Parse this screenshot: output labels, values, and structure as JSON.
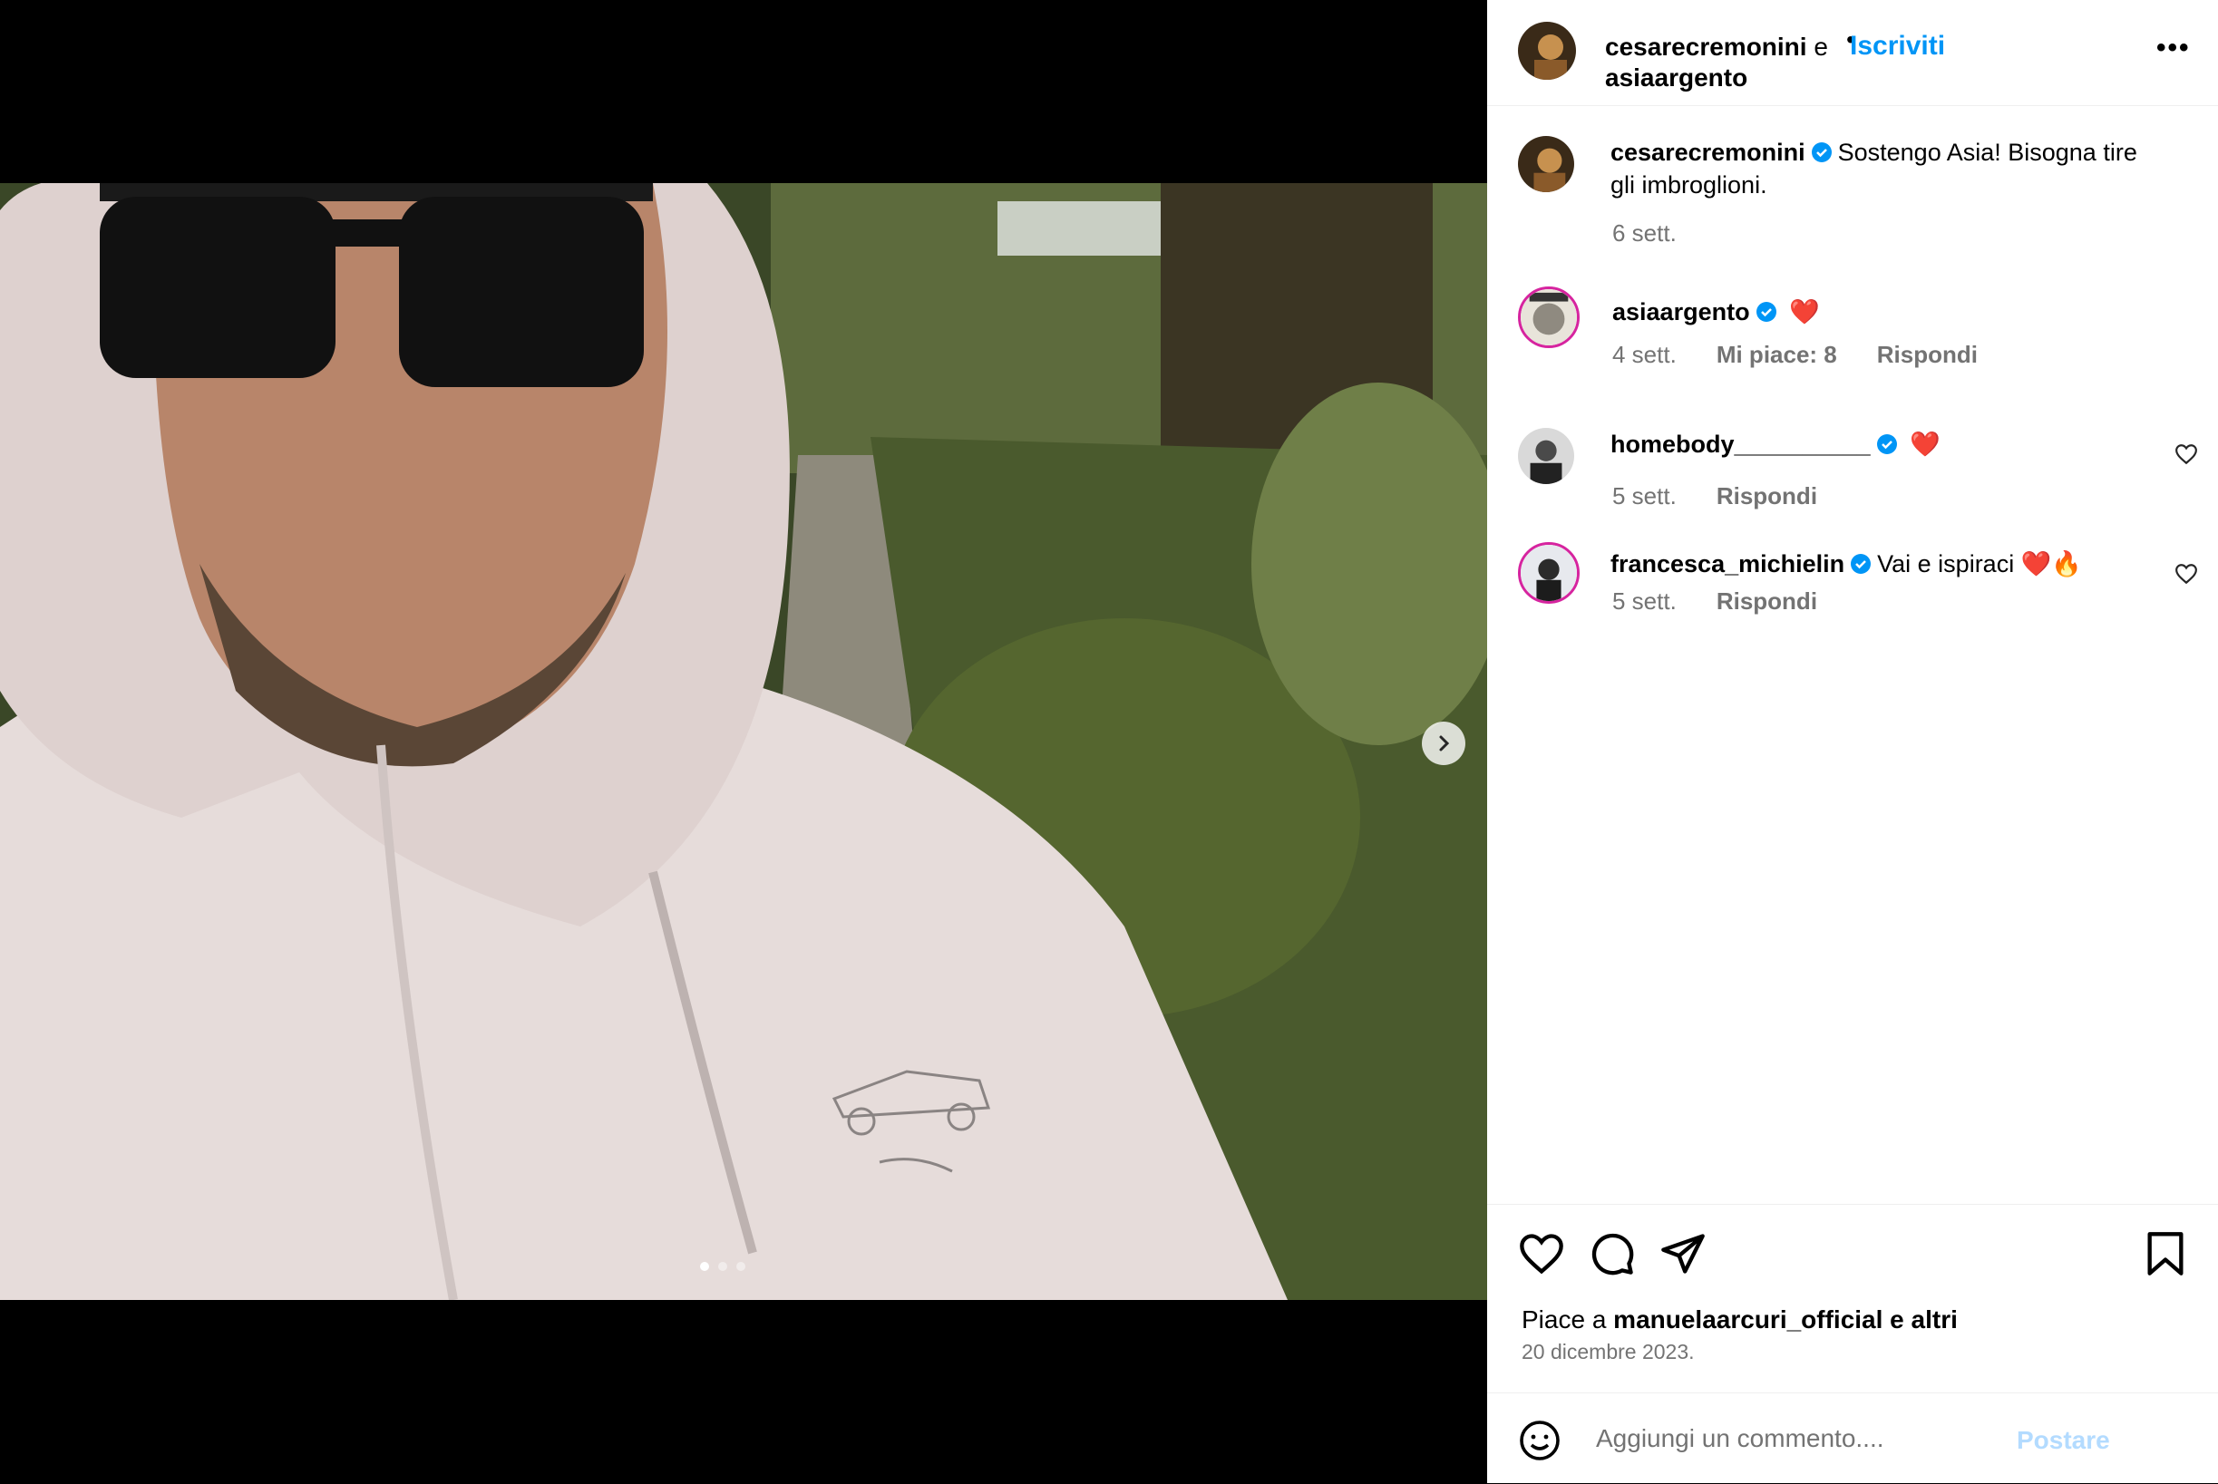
{
  "colors": {
    "accent": "#0095f6",
    "verified": "#0095f6",
    "muted": "#737373",
    "heart": "#e0141e",
    "post_disabled": "#b3dbff"
  },
  "header": {
    "author": "cesarecremonini",
    "conjunction": "e",
    "collaborator": "asiaargento",
    "bullet": "•",
    "follow_label": "Iscriviti",
    "more_label": "•••"
  },
  "caption": {
    "username": "cesarecremonini",
    "text_line1": "Sostengo Asia! Bisogna tire",
    "text_line2": "gli imbroglioni.",
    "time": "6 sett."
  },
  "comments": [
    {
      "username": "asiaargento",
      "text": "❤️",
      "time": "4 sett.",
      "likes": "Mi piace: 8",
      "reply": "Rispondi"
    },
    {
      "username": "homebody__________",
      "text": "❤️",
      "time": "5 sett.",
      "reply": "Rispondi"
    },
    {
      "username": "francesca_michielin",
      "text": "Vai e ispiraci ❤️🔥",
      "time": "5 sett.",
      "reply": "Rispondi"
    }
  ],
  "actions": {
    "icons": [
      "heart-icon",
      "comment-icon",
      "share-icon",
      "bookmark-icon"
    ]
  },
  "likes": {
    "prefix": "Piace a ",
    "user": "manuelaarcuri_official",
    "suffix": " e altri"
  },
  "date": "20 dicembre 2023.",
  "add_comment": {
    "placeholder": "Aggiungi un commento....",
    "post_label": "Postare"
  },
  "carousel": {
    "current": 1,
    "total": 3
  }
}
